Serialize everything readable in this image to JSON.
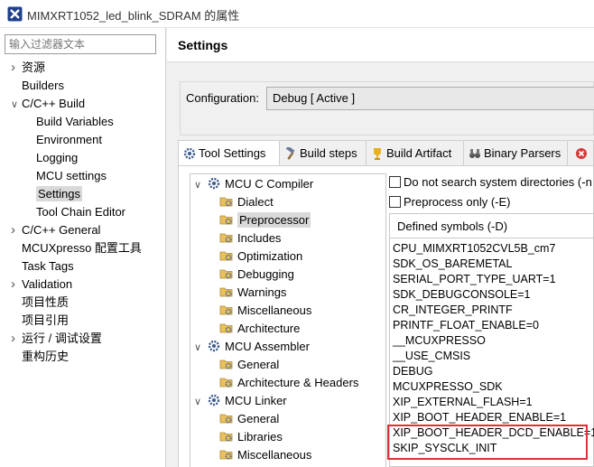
{
  "window": {
    "title": "MIMXRT1052_led_blink_SDRAM 的属性",
    "icon": "eclipse-x-icon"
  },
  "filter": {
    "placeholder": "输入过滤器文本"
  },
  "sidebar": {
    "items": [
      {
        "label": "资源",
        "chevron": ">"
      },
      {
        "label": "Builders",
        "chevron": ""
      },
      {
        "label": "C/C++ Build",
        "chevron": "v"
      },
      {
        "label": "Build Variables",
        "chevron": ""
      },
      {
        "label": "Environment",
        "chevron": ""
      },
      {
        "label": "Logging",
        "chevron": ""
      },
      {
        "label": "MCU settings",
        "chevron": ""
      },
      {
        "label": "Settings",
        "chevron": "",
        "selected": true
      },
      {
        "label": "Tool Chain Editor",
        "chevron": ""
      },
      {
        "label": "C/C++ General",
        "chevron": ">"
      },
      {
        "label": "MCUXpresso 配置工具",
        "chevron": ""
      },
      {
        "label": "Task Tags",
        "chevron": ""
      },
      {
        "label": "Validation",
        "chevron": ">"
      },
      {
        "label": "项目性质",
        "chevron": ""
      },
      {
        "label": "项目引用",
        "chevron": ""
      },
      {
        "label": "运行 / 调试设置",
        "chevron": ">"
      },
      {
        "label": "重构历史",
        "chevron": ""
      }
    ]
  },
  "header": {
    "title": "Settings"
  },
  "configuration": {
    "label": "Configuration:",
    "value": "Debug  [ Active ]"
  },
  "tabs": [
    {
      "label": "Tool Settings",
      "icon": "gear-icon",
      "active": true
    },
    {
      "label": "Build steps",
      "icon": "hammer-icon"
    },
    {
      "label": "Build Artifact",
      "icon": "trophy-icon"
    },
    {
      "label": "Binary Parsers",
      "icon": "binoculars-icon"
    },
    {
      "label": "",
      "icon": "error-icon"
    }
  ],
  "tree": {
    "nodes": [
      {
        "label": "MCU C Compiler",
        "expanded": true,
        "icon": "gear-icon"
      },
      {
        "label": "Dialect",
        "icon": "folder-gear-icon"
      },
      {
        "label": "Preprocessor",
        "icon": "folder-gear-icon",
        "selected": true
      },
      {
        "label": "Includes",
        "icon": "folder-gear-icon"
      },
      {
        "label": "Optimization",
        "icon": "folder-gear-icon"
      },
      {
        "label": "Debugging",
        "icon": "folder-gear-icon"
      },
      {
        "label": "Warnings",
        "icon": "folder-gear-icon"
      },
      {
        "label": "Miscellaneous",
        "icon": "folder-gear-icon"
      },
      {
        "label": "Architecture",
        "icon": "folder-gear-icon"
      },
      {
        "label": "MCU Assembler",
        "expanded": true,
        "icon": "gear-icon"
      },
      {
        "label": "General",
        "icon": "folder-gear-icon"
      },
      {
        "label": "Architecture & Headers",
        "icon": "folder-gear-icon"
      },
      {
        "label": "MCU Linker",
        "expanded": true,
        "icon": "gear-icon"
      },
      {
        "label": "General",
        "icon": "folder-gear-icon"
      },
      {
        "label": "Libraries",
        "icon": "folder-gear-icon"
      },
      {
        "label": "Miscellaneous",
        "icon": "folder-gear-icon"
      }
    ]
  },
  "options": {
    "no_system_dirs": {
      "label": "Do not search system directories (-n",
      "checked": false
    },
    "preprocess_only": {
      "label": "Preprocess only (-E)",
      "checked": false
    }
  },
  "symbols": {
    "header": "Defined symbols (-D)",
    "items": [
      "CPU_MIMXRT1052CVL5B_cm7",
      "SDK_OS_BAREMETAL",
      "SERIAL_PORT_TYPE_UART=1",
      "SDK_DEBUGCONSOLE=1",
      "CR_INTEGER_PRINTF",
      "PRINTF_FLOAT_ENABLE=0",
      "__MCUXPRESSO",
      "__USE_CMSIS",
      "DEBUG",
      "MCUXPRESSO_SDK",
      "XIP_EXTERNAL_FLASH=1",
      "XIP_BOOT_HEADER_ENABLE=1",
      "XIP_BOOT_HEADER_DCD_ENABLE=1",
      "SKIP_SYSCLK_INIT"
    ]
  },
  "colors": {
    "highlight": "#e0303a",
    "selection": "#d9d9d9",
    "accent": "#1e3f8a"
  }
}
